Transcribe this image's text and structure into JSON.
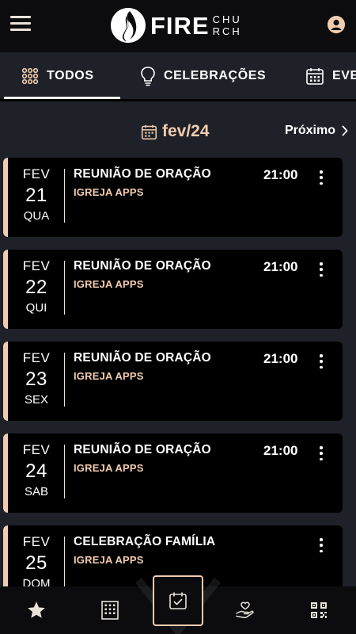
{
  "header": {
    "logo_word": "FIRE",
    "logo_sub_line1": "CHU",
    "logo_sub_line2": "RCH",
    "menu_icon": "hamburger-menu-icon",
    "profile_icon": "account-circle-icon"
  },
  "tabs": [
    {
      "label": "TODOS",
      "icon": "grid-dots-icon",
      "active": true
    },
    {
      "label": "CELEBRAÇÕES",
      "icon": "lightbulb-icon",
      "active": false
    },
    {
      "label": "EVE",
      "icon": "calendar-icon",
      "active": false
    }
  ],
  "month_nav": {
    "month_label": "fev/24",
    "next_label": "Próximo"
  },
  "events": [
    {
      "month": "FEV",
      "day": "21",
      "weekday": "QUA",
      "title": "REUNIÃO DE ORAÇÃO",
      "org": "IGREJA APPS",
      "time": "21:00"
    },
    {
      "month": "FEV",
      "day": "22",
      "weekday": "QUI",
      "title": "REUNIÃO DE ORAÇÃO",
      "org": "IGREJA APPS",
      "time": "21:00"
    },
    {
      "month": "FEV",
      "day": "23",
      "weekday": "SEX",
      "title": "REUNIÃO DE ORAÇÃO",
      "org": "IGREJA APPS",
      "time": "21:00"
    },
    {
      "month": "FEV",
      "day": "24",
      "weekday": "SAB",
      "title": "REUNIÃO DE ORAÇÃO",
      "org": "IGREJA APPS",
      "time": "21:00"
    },
    {
      "month": "FEV",
      "day": "25",
      "weekday": "DOM",
      "title": "CELEBRAÇÃO FAMÍLIA",
      "org": "IGREJA APPS",
      "time": ""
    }
  ],
  "bottom_nav": [
    {
      "icon": "star-icon",
      "active": false
    },
    {
      "icon": "building-icon",
      "active": false
    },
    {
      "icon": "calendar-check-icon",
      "active": true
    },
    {
      "icon": "hand-heart-icon",
      "active": false
    },
    {
      "icon": "qr-code-icon",
      "active": false
    }
  ],
  "colors": {
    "background": "#1e2127",
    "bar": "#0c0c0e",
    "card": "#000000",
    "accent": "#f1ccb0",
    "text": "#ffffff"
  }
}
